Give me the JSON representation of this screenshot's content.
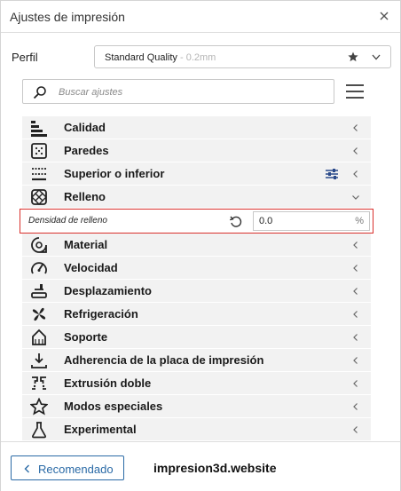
{
  "window": {
    "title": "Ajustes de impresión"
  },
  "profile": {
    "label": "Perfil",
    "name": "Standard Quality",
    "sub": " - 0.2mm"
  },
  "search": {
    "placeholder": "Buscar ajustes"
  },
  "categories": [
    {
      "label": "Calidad",
      "icon": "quality-icon"
    },
    {
      "label": "Paredes",
      "icon": "walls-icon"
    },
    {
      "label": "Superior o inferior",
      "icon": "top-bottom-icon"
    },
    {
      "label": "Relleno",
      "icon": "infill-icon"
    },
    {
      "label": "Material",
      "icon": "material-icon"
    },
    {
      "label": "Velocidad",
      "icon": "speed-icon"
    },
    {
      "label": "Desplazamiento",
      "icon": "travel-icon"
    },
    {
      "label": "Refrigeración",
      "icon": "cooling-icon"
    },
    {
      "label": "Soporte",
      "icon": "support-icon"
    },
    {
      "label": "Adherencia de la placa de impresión",
      "icon": "adhesion-icon"
    },
    {
      "label": "Extrusión doble",
      "icon": "dual-extrusion-icon"
    },
    {
      "label": "Modos especiales",
      "icon": "special-modes-icon"
    },
    {
      "label": "Experimental",
      "icon": "experimental-icon"
    }
  ],
  "setting": {
    "label": "Densidad de relleno",
    "value": "0.0",
    "unit": "%"
  },
  "footer": {
    "recommended": "Recomendado",
    "watermark": "impresion3d.website"
  },
  "colors": {
    "accent": "#2a6aa6",
    "highlight_border": "#d9302c",
    "row_bg": "#f2f2f2"
  }
}
